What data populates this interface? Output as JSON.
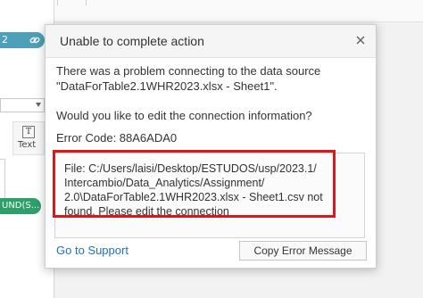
{
  "background": {
    "top_pill": {
      "text": "2"
    },
    "text_tile": {
      "icon_glyph": "T",
      "label": "Text"
    },
    "bottom_pill": {
      "text": "UND(S..."
    }
  },
  "dialog": {
    "title": "Unable to complete action",
    "message_line1": "There was a problem connecting to the data source",
    "message_line2": "\"DataForTable2.1WHR2023.xlsx - Sheet1\".",
    "question": "Would you like to edit the connection information?",
    "error_code": "Error Code: 88A6ADA0",
    "details": "File: C:/Users/laisi/Desktop/ESTUDOS/usp/2023.1/\nIntercambio/Data_Analytics/Assignment/\n2.0\\DataForTable2.1WHR2023.xlsx - Sheet1.csv not\nfound. Please edit the connection",
    "support_link": "Go to Support",
    "copy_button": "Copy Error Message"
  },
  "colors": {
    "highlight": "#e1141a",
    "link": "#1f72b8",
    "pill_blue": "#4e9fb7",
    "pill_green": "#2e9e6b"
  }
}
